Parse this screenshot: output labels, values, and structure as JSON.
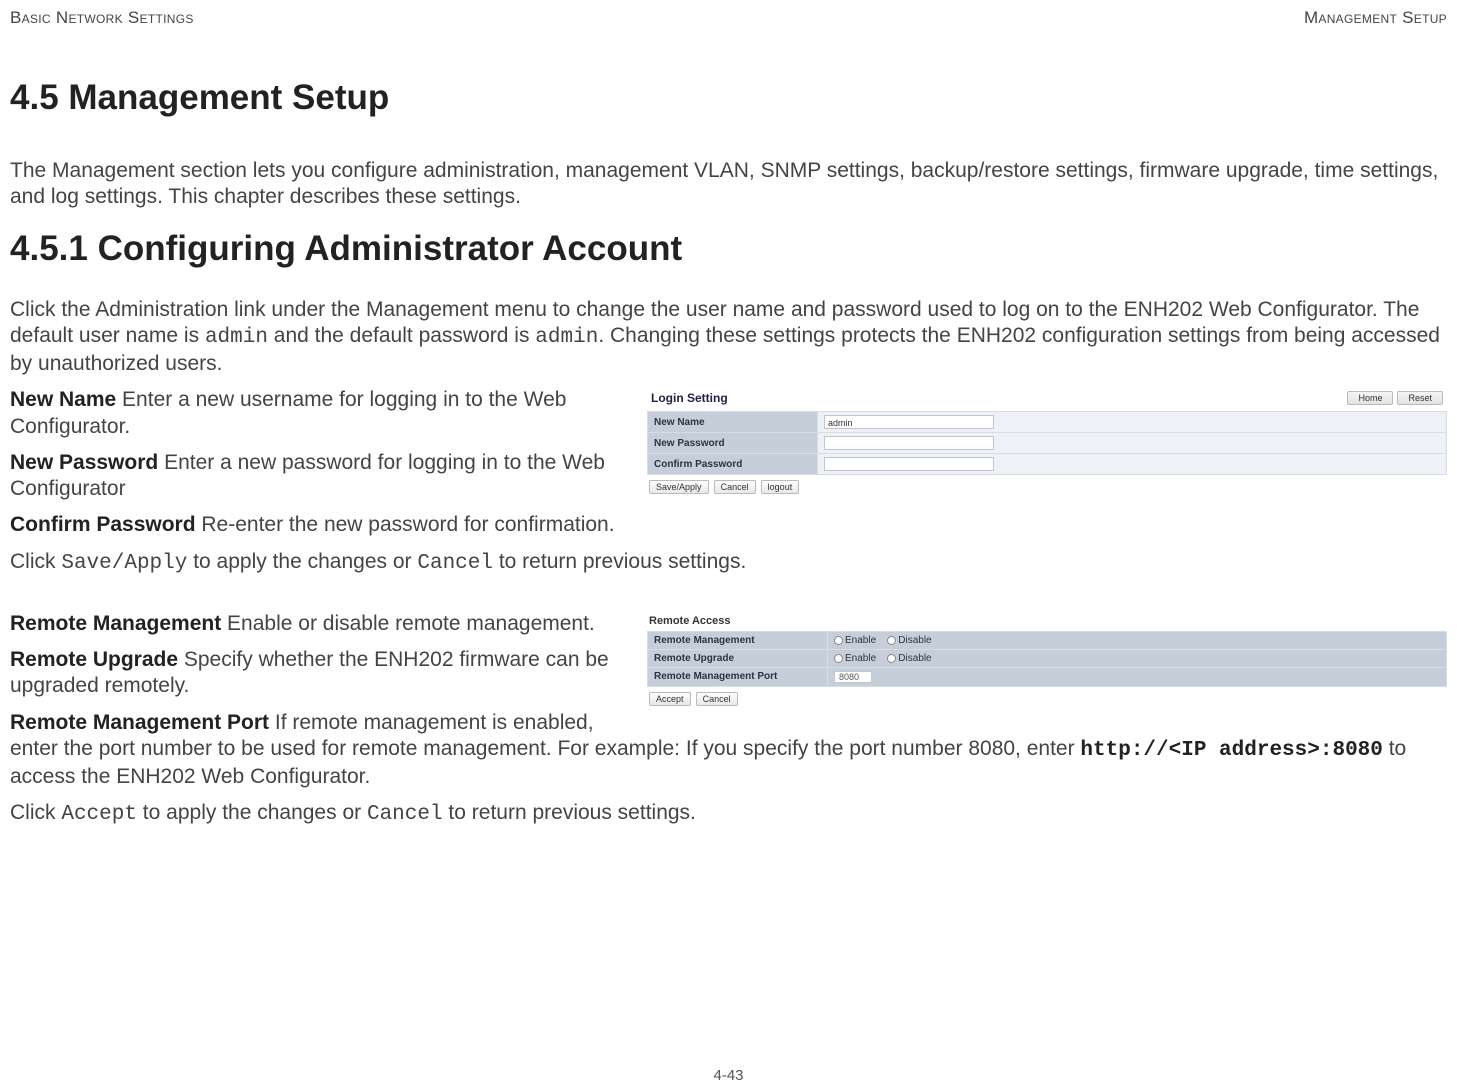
{
  "header": {
    "left": "Basic Network Settings",
    "right": "Management Setup"
  },
  "section_heading": "4.5 Management Setup",
  "intro": "The Management section lets you configure administration, management VLAN, SNMP settings, backup/restore settings, firmware upgrade, time settings, and log settings. This chapter describes these settings.",
  "subsection_heading": "4.5.1 Configuring Administrator Account",
  "admin_intro_a": "Click the Administration link under the Management menu to change the user name and password used to log on to the ENH202 Web Configurator. The default user name is ",
  "admin_intro_code1": "admin",
  "admin_intro_b": " and the default password is ",
  "admin_intro_code2": "admin",
  "admin_intro_c": ". Changing these settings protects the ENH202 configuration settings from being accessed by unauthorized users.",
  "defs1": {
    "new_name_label": "New Name",
    "new_name_text": "  Enter a new username for logging in to the Web Configurator.",
    "new_password_label": "New Password",
    "new_password_text": "  Enter a new password for logging in to the Web Configurator",
    "confirm_password_label": "Confirm Password",
    "confirm_password_text": "  Re-enter the new password for confirmation."
  },
  "apply1_a": "Click ",
  "apply1_code1": "Save/Apply",
  "apply1_b": " to apply the changes or ",
  "apply1_code2": "Cancel",
  "apply1_c": " to return previous settings.",
  "defs2": {
    "remote_mgmt_label": "Remote Management",
    "remote_mgmt_text": "  Enable or disable remote management.",
    "remote_upgrade_label": "Remote Upgrade",
    "remote_upgrade_text": "  Specify whether the ENH202 firmware can be upgraded remotely.",
    "remote_port_label": "Remote Management Port",
    "remote_port_text_a": "  If remote management is enabled, enter the port number to be used for remote management. For example: If you specify the port number 8080, enter ",
    "remote_port_code": "http://<IP address>:8080",
    "remote_port_text_b": " to access the ENH202 Web Configurator."
  },
  "apply2_a": "Click ",
  "apply2_code1": "Accept",
  "apply2_b": " to apply the changes or ",
  "apply2_code2": "Cancel",
  "apply2_c": " to return previous settings.",
  "page_number": "4-43",
  "fig1": {
    "title": "Login Setting",
    "home": "Home",
    "reset": "Reset",
    "row_new_name": "New Name",
    "row_new_name_val": "admin",
    "row_new_password": "New Password",
    "row_confirm_password": "Confirm Password",
    "btn_save": "Save/Apply",
    "btn_cancel": "Cancel",
    "btn_logout": "logout"
  },
  "fig2": {
    "title": "Remote Access",
    "row_mgmt": "Remote Management",
    "row_upgrade": "Remote Upgrade",
    "row_port": "Remote Management Port",
    "opt_enable": "Enable",
    "opt_disable": "Disable",
    "port_value": "8080",
    "btn_accept": "Accept",
    "btn_cancel": "Cancel"
  }
}
